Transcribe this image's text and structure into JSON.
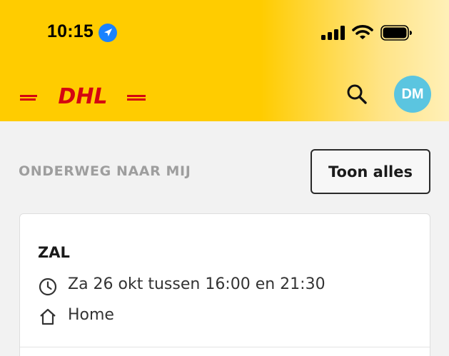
{
  "status_bar": {
    "time": "10:15",
    "icons": [
      "location-arrow-icon",
      "signal-icon",
      "wifi-icon",
      "battery-icon"
    ]
  },
  "header": {
    "logo": "DHL",
    "search_icon": "search-icon",
    "avatar_initials": "DM",
    "colors": {
      "brand_yellow": "#ffcc00",
      "brand_red": "#d40511",
      "avatar": "#5bc5e0"
    }
  },
  "section": {
    "title": "ONDERWEG NAAR MIJ",
    "show_all_label": "Toon alles"
  },
  "shipments": [
    {
      "shipper": "ZAL",
      "delivery_time": "Za 26 okt tussen 16:00 en 21:30",
      "destination": "Home",
      "icons": [
        "clock-icon",
        "home-icon"
      ]
    }
  ]
}
